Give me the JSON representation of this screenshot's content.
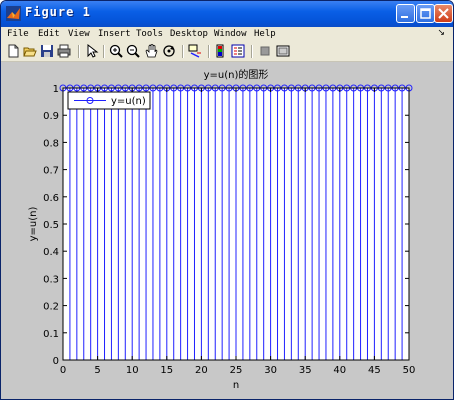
{
  "window": {
    "title": "Figure 1",
    "controls": {
      "minimize_icon": "minimize-icon",
      "maximize_icon": "maximize-icon",
      "close_icon": "close-icon"
    }
  },
  "menu": {
    "items": [
      {
        "label": "File"
      },
      {
        "label": "Edit"
      },
      {
        "label": "View"
      },
      {
        "label": "Insert"
      },
      {
        "label": "Tools"
      },
      {
        "label": "Desktop"
      },
      {
        "label": "Window"
      },
      {
        "label": "Help"
      }
    ]
  },
  "toolbar": {
    "icons": [
      "new-figure-icon",
      "open-file-icon",
      "save-icon",
      "print-icon",
      "select-arrow-icon",
      "zoom-in-icon",
      "zoom-out-icon",
      "pan-hand-icon",
      "rotate-3d-icon",
      "data-cursor-icon",
      "colorbar-icon",
      "legend-icon",
      "hide-plot-tools-icon",
      "show-plot-tools-icon"
    ]
  },
  "colors": {
    "stem": "#2020ff",
    "axes_bg": "#ffffff",
    "figure_bg": "#c8c8c8"
  },
  "chart_data": {
    "type": "stem",
    "title": "y=u(n)的图形",
    "xlabel": "n",
    "ylabel": "y=u(n)",
    "xlim": [
      0,
      50
    ],
    "ylim": [
      0,
      1
    ],
    "xticks": [
      "0",
      "5",
      "10",
      "15",
      "20",
      "25",
      "30",
      "35",
      "40",
      "45",
      "50"
    ],
    "yticks": [
      "0",
      "0.1",
      "0.2",
      "0.3",
      "0.4",
      "0.5",
      "0.6",
      "0.7",
      "0.8",
      "0.9",
      "1"
    ],
    "legend": {
      "label": "y=u(n)",
      "placement": "top-left"
    },
    "series": [
      {
        "name": "y=u(n)",
        "x": [
          0,
          1,
          2,
          3,
          4,
          5,
          6,
          7,
          8,
          9,
          10,
          11,
          12,
          13,
          14,
          15,
          16,
          17,
          18,
          19,
          20,
          21,
          22,
          23,
          24,
          25,
          26,
          27,
          28,
          29,
          30,
          31,
          32,
          33,
          34,
          35,
          36,
          37,
          38,
          39,
          40,
          41,
          42,
          43,
          44,
          45,
          46,
          47,
          48,
          49,
          50
        ],
        "values": [
          1,
          1,
          1,
          1,
          1,
          1,
          1,
          1,
          1,
          1,
          1,
          1,
          1,
          1,
          1,
          1,
          1,
          1,
          1,
          1,
          1,
          1,
          1,
          1,
          1,
          1,
          1,
          1,
          1,
          1,
          1,
          1,
          1,
          1,
          1,
          1,
          1,
          1,
          1,
          1,
          1,
          1,
          1,
          1,
          1,
          1,
          1,
          1,
          1,
          1,
          1
        ]
      }
    ]
  }
}
